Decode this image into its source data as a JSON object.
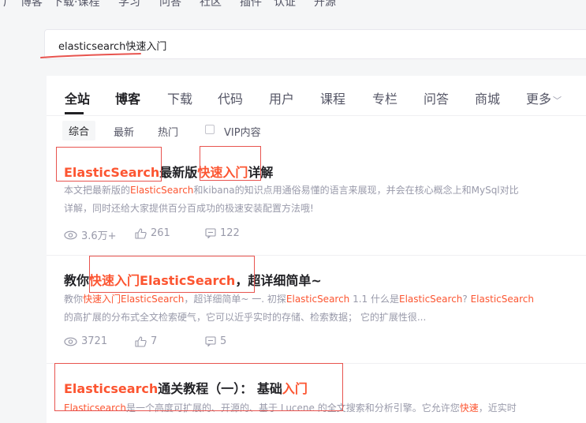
{
  "top_nav": [
    "广",
    "博客",
    "下载·课程",
    "学习",
    "问答",
    "社区",
    "插件",
    "认证",
    "开源"
  ],
  "search": {
    "value": "elasticsearch快速入门"
  },
  "tabs": [
    "全站",
    "博客",
    "下载",
    "代码",
    "用户",
    "课程",
    "专栏",
    "问答",
    "商城",
    "更多"
  ],
  "filters": {
    "comprehensive": "综合",
    "latest": "最新",
    "hot": "热门",
    "vip": "VIP内容"
  },
  "results": [
    {
      "title": [
        {
          "t": "ElasticSearch",
          "hl": true
        },
        {
          "t": "最新版",
          "hl": false
        },
        {
          "t": "快速入门",
          "hl": true
        },
        {
          "t": "详解",
          "hl": false
        }
      ],
      "desc1": [
        {
          "t": "本文把最新版的",
          "hl": false
        },
        {
          "t": "ElasticSearch",
          "hl": true
        },
        {
          "t": "和kibana的知识点用通俗易懂的语言来展现，并会在核心概念上和MySql对比",
          "hl": false
        }
      ],
      "desc2": [
        {
          "t": "详解，同时还给大家提供百分百成功的极速安装配置方法哦!",
          "hl": false
        }
      ],
      "views": "3.6万+",
      "likes": "261",
      "comments": "122"
    },
    {
      "title": [
        {
          "t": "教你",
          "hl": false
        },
        {
          "t": "快速入门ElasticSearch",
          "hl": true
        },
        {
          "t": "，超详细简单~",
          "hl": false
        }
      ],
      "desc1": [
        {
          "t": "教你",
          "hl": false
        },
        {
          "t": "快速入门ElasticSearch",
          "hl": true
        },
        {
          "t": "，超详细简单~ 一. 初探",
          "hl": false
        },
        {
          "t": "ElasticSearch",
          "hl": true
        },
        {
          "t": " 1.1 什么是",
          "hl": false
        },
        {
          "t": "ElasticSearch",
          "hl": true
        },
        {
          "t": "?  ",
          "hl": false
        },
        {
          "t": "ElasticSearch",
          "hl": true
        }
      ],
      "desc2": [
        {
          "t": "的高扩展的分布式全文检索硬气，它可以近乎实时的存储、检索数据；  它的扩展性很...",
          "hl": false
        }
      ],
      "views": "3721",
      "likes": "7",
      "comments": "5"
    },
    {
      "title": [
        {
          "t": "Elasticsearch",
          "hl": true
        },
        {
          "t": "通关教程（一）：  基础",
          "hl": false
        },
        {
          "t": "入门",
          "hl": true
        }
      ],
      "desc1": [
        {
          "t": "Elasticsearch",
          "hl": true
        },
        {
          "t": "是一个高度可扩展的、开源的、基于 Lucene 的全文搜索和分析引擎。它允许您",
          "hl": false
        },
        {
          "t": "快速",
          "hl": true
        },
        {
          "t": "，近实时",
          "hl": false
        }
      ]
    }
  ],
  "colors": {
    "highlight": "#fc5531",
    "annotation": "#e8544f",
    "text": "#222226",
    "muted": "#999aaa"
  }
}
